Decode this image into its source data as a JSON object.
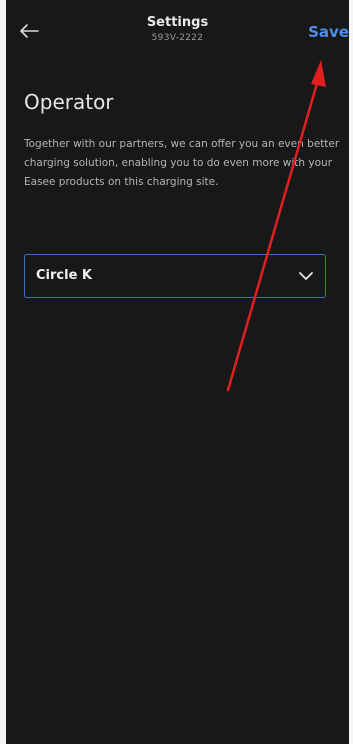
{
  "header": {
    "back_icon": "arrow-left-icon",
    "title": "Settings",
    "subtitle": "593V-2222",
    "save_label": "Save"
  },
  "section": {
    "title": "Operator",
    "description": "Together with our partners, we can offer you an even better charging solution, enabling you to do even more with your Easee products on this charging site."
  },
  "operator_select": {
    "selected_value": "Circle K",
    "chevron_icon": "chevron-down-icon"
  },
  "annotation": {
    "type": "red-arrow",
    "points_to": "save-button",
    "color": "#e02020"
  },
  "colors": {
    "background": "#181818",
    "accent": "#4d8fe8",
    "select_border": "#3c6ec8",
    "text_primary": "#e6e6e6",
    "text_secondary": "#b4b4b4"
  }
}
